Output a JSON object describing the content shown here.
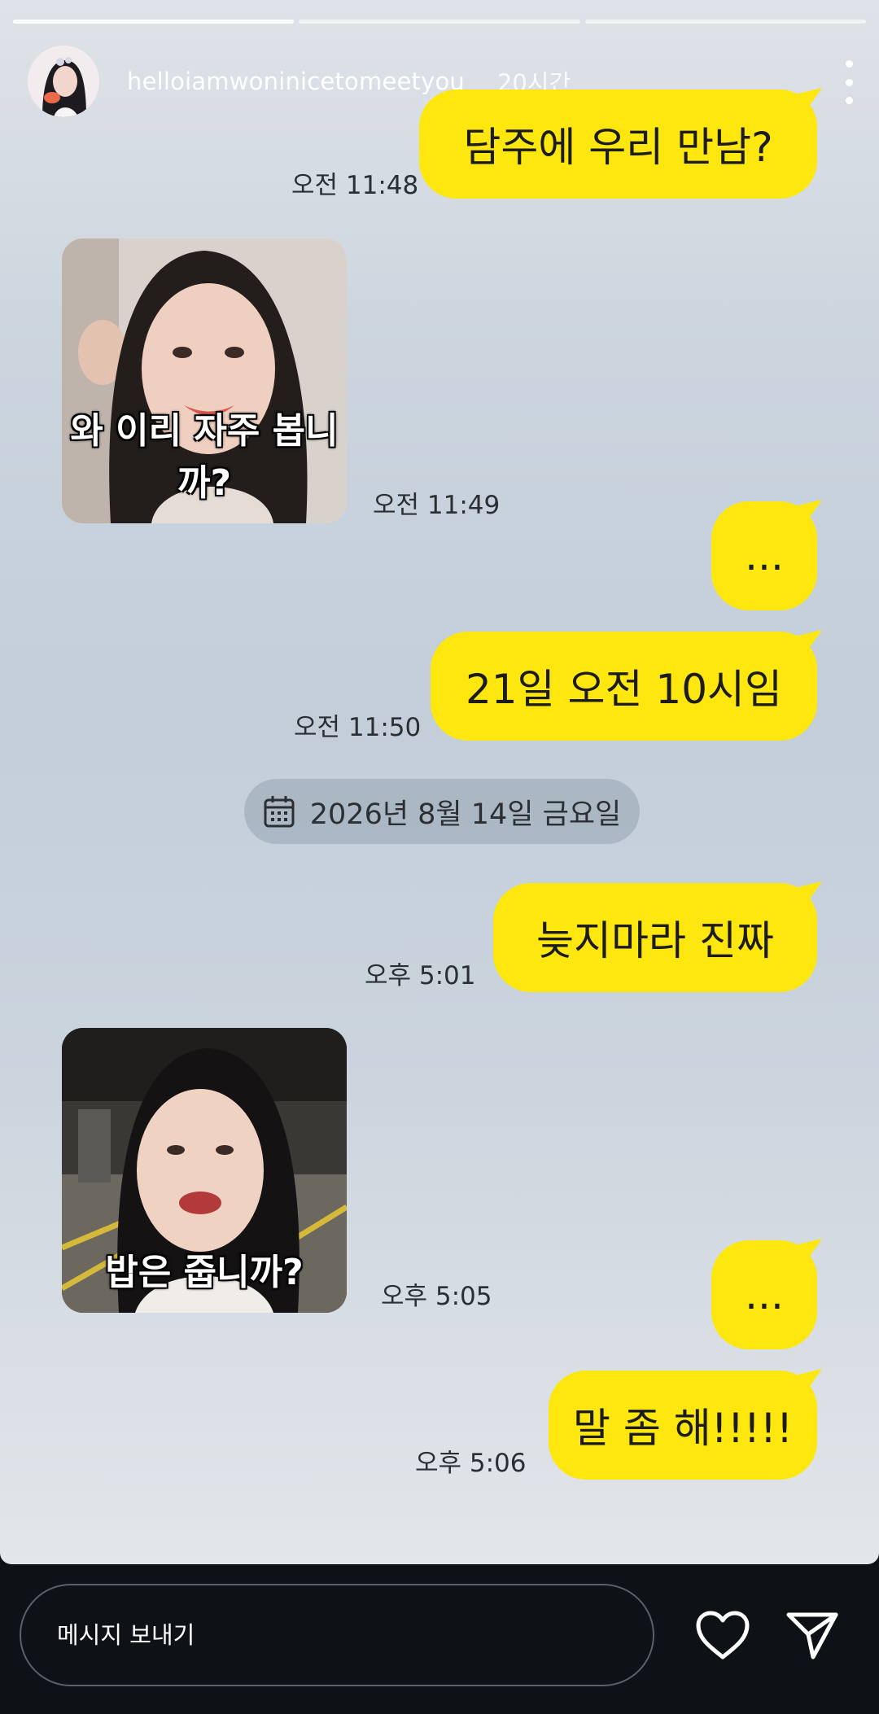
{
  "story": {
    "username": "helloiamwoninicetomeetyou",
    "age": "20시간",
    "progress": [
      1.0,
      0.0,
      0.0
    ],
    "avatar_alt": "profile-photo"
  },
  "chat": {
    "messages": [
      {
        "text": "담주에 우리 만남?",
        "time": "오전 11:48"
      },
      {
        "sticker_caption": "와 이리 자주 봅니까?",
        "time": "오전 11:49"
      },
      {
        "text": "...",
        "time": ""
      },
      {
        "text": "21일 오전 10시임",
        "time": "오전 11:50"
      },
      {
        "text": "늦지마라 진짜",
        "time": "오후 5:01"
      },
      {
        "sticker_caption": "밥은 줍니까?",
        "time": "오후 5:05"
      },
      {
        "text": "...",
        "time": ""
      },
      {
        "text": "말 좀 해!!!!!",
        "time": "오후 5:06"
      }
    ],
    "date_divider": "2026년 8월 14일 금요일"
  },
  "footer": {
    "message_placeholder": "메시지 보내기"
  },
  "colors": {
    "bubble": "#fde70f",
    "background": "#c6d0da",
    "bar": "#0e1116"
  }
}
